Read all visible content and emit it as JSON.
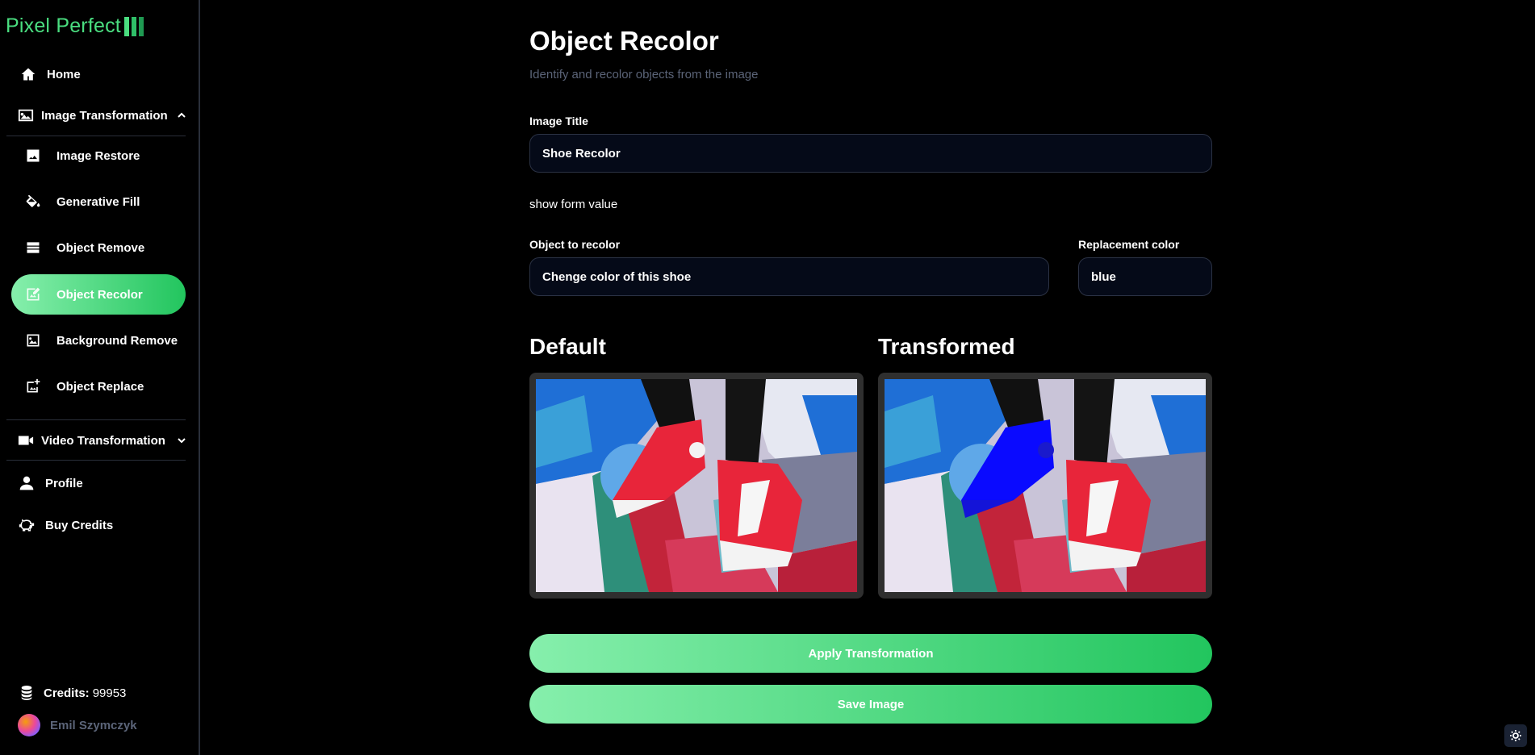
{
  "app": {
    "logo_text": "Pixel Perfect"
  },
  "sidebar": {
    "home": "Home",
    "image_group": "Image Transformation",
    "image_items": [
      {
        "label": "Image Restore",
        "icon": "image-icon"
      },
      {
        "label": "Generative Fill",
        "icon": "paint-bucket-icon"
      },
      {
        "label": "Object Remove",
        "icon": "layers-icon"
      },
      {
        "label": "Object Recolor",
        "icon": "image-edit-icon",
        "active": true
      },
      {
        "label": "Background Remove",
        "icon": "image-frame-icon"
      },
      {
        "label": "Object Replace",
        "icon": "image-plus-icon"
      }
    ],
    "video_group": "Video Transformation",
    "profile": "Profile",
    "buy_credits": "Buy Credits",
    "credits_label": "Credits:",
    "credits_value": "99953",
    "user_name": "Emil Szymczyk"
  },
  "main": {
    "title": "Object Recolor",
    "subtitle": "Identify and recolor objects from the image",
    "image_title_label": "Image Title",
    "image_title_value": "Shoe Recolor",
    "show_form_value": "show form value",
    "object_label": "Object to recolor",
    "object_value": "Chenge color of this shoe",
    "color_label": "Replacement color",
    "color_value": "blue",
    "default_heading": "Default",
    "transformed_heading": "Transformed",
    "apply_button": "Apply Transformation",
    "save_button": "Save Image"
  },
  "colors": {
    "accent_start": "#86efac",
    "accent_end": "#22c55e",
    "muted_text": "#5b6478",
    "input_bg": "#050a18",
    "recolor": "#0a0aff"
  }
}
